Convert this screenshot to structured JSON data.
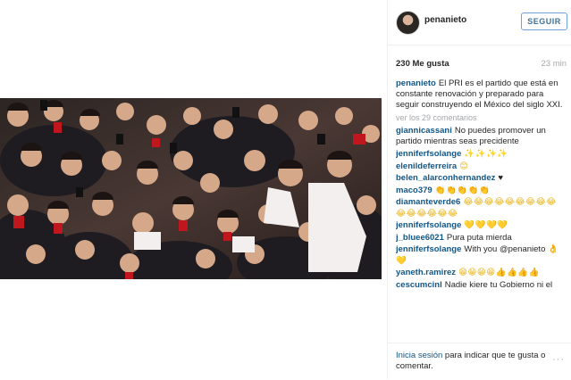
{
  "post": {
    "username": "penanieto",
    "follow_label": "SEGUIR",
    "likes": "230 Me gusta",
    "time": "23 min",
    "photo_alt": "Foto de multitud"
  },
  "caption": {
    "user": "penanieto",
    "text": "El PRI es el partido que está en constante renovación y preparado para seguir construyendo el México del siglo XXI."
  },
  "view_comments": "ver los 29 comentarios",
  "comments": [
    {
      "user": "giannicassani",
      "text": "No puedes promover un partido mientras seas precidente"
    },
    {
      "user": "jenniferfsolange",
      "text": "✨✨✨✨"
    },
    {
      "user": "elenildeferreira",
      "text": "😊"
    },
    {
      "user": "belen_alarconhernandez",
      "text": "♥"
    },
    {
      "user": "maco379",
      "text": "👏👏👏👏👏"
    },
    {
      "user": "diamanteverde6",
      "text": "😂😂😂😂😂😂😂😂😂😂😂😂😂😂😂"
    },
    {
      "user": "jenniferfsolange",
      "text": "💛💛💛💛"
    },
    {
      "user": "j_bluee6021",
      "text": "Pura puta mierda"
    },
    {
      "user": "jenniferfsolange",
      "text": "With you @penanieto 👌💛"
    },
    {
      "user": "yaneth.ramirez",
      "text": "😁😁😁😁👍👍👍👍"
    },
    {
      "user": "cescumcinl",
      "text": "Nadie kiere tu Gobierno ni el"
    }
  ],
  "footer": {
    "login_link": "Inicia sesión",
    "login_rest": " para indicar que te gusta o comentar.",
    "more_icon": "ellipsis-icon",
    "more_text": "···"
  },
  "colors": {
    "username": "#125688",
    "follow": "#3f729b",
    "muted": "#a5a7aa"
  }
}
